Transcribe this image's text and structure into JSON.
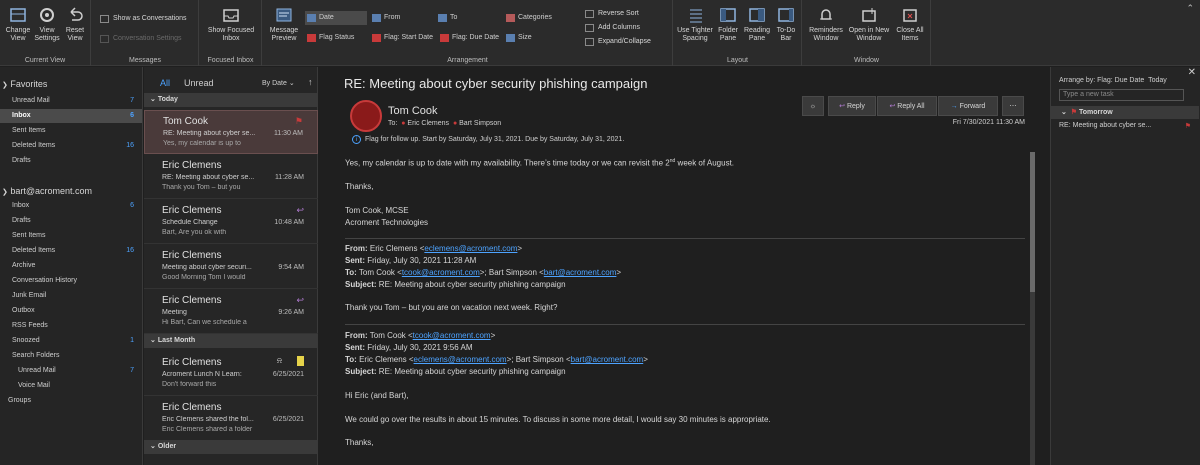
{
  "ribbon": {
    "current_view": {
      "label": "Current View",
      "change_view": "Change View",
      "view_settings": "View Settings",
      "reset_view": "Reset View"
    },
    "messages": {
      "label": "Messages",
      "show_as_conversations": "Show as Conversations",
      "conversation_settings": "Conversation Settings"
    },
    "focused_inbox": {
      "label": "Focused Inbox",
      "show_focused_inbox": "Show Focused Inbox"
    },
    "arrangement": {
      "label": "Arrangement",
      "message_preview": "Message Preview",
      "date": "Date",
      "from": "From",
      "to": "To",
      "categories": "Categories",
      "flag_status": "Flag Status",
      "flag_start_date": "Flag: Start Date",
      "flag_due_date": "Flag: Due Date",
      "size": "Size",
      "reverse_sort": "Reverse Sort",
      "add_columns": "Add Columns",
      "expand_collapse": "Expand/Collapse"
    },
    "layout": {
      "label": "Layout",
      "use_tighter_spacing": "Use Tighter Spacing",
      "folder_pane": "Folder Pane",
      "reading_pane": "Reading Pane",
      "todo_bar": "To-Do Bar"
    },
    "window": {
      "label": "Window",
      "reminders_window": "Reminders Window",
      "open_new_window": "Open in New Window",
      "close_all_items": "Close All Items"
    }
  },
  "folders": {
    "favorites_header": "Favorites",
    "favorites": [
      {
        "label": "Unread Mail",
        "count": "7"
      },
      {
        "label": "Inbox",
        "count": "6"
      },
      {
        "label": "Sent Items",
        "count": ""
      },
      {
        "label": "Deleted Items",
        "count": "16"
      },
      {
        "label": "Drafts",
        "count": ""
      }
    ],
    "account_header": "bart@acroment.com",
    "account": [
      {
        "label": "Inbox",
        "count": "6"
      },
      {
        "label": "Drafts",
        "count": ""
      },
      {
        "label": "Sent Items",
        "count": ""
      },
      {
        "label": "Deleted Items",
        "count": "16"
      },
      {
        "label": "Archive",
        "count": ""
      },
      {
        "label": "Conversation History",
        "count": ""
      },
      {
        "label": "Junk Email",
        "count": ""
      },
      {
        "label": "Outbox",
        "count": ""
      },
      {
        "label": "RSS Feeds",
        "count": ""
      },
      {
        "label": "Snoozed",
        "count": "1"
      },
      {
        "label": "Search Folders",
        "count": ""
      },
      {
        "label": "Unread Mail",
        "count": "7"
      },
      {
        "label": "Voice Mail",
        "count": ""
      },
      {
        "label": "Groups",
        "count": ""
      }
    ]
  },
  "list": {
    "tab_all": "All",
    "tab_unread": "Unread",
    "sort_label": "By Date",
    "today": "Today",
    "last_month": "Last Month",
    "older": "Older",
    "messages": [
      {
        "from": "Tom Cook",
        "subject": "RE: Meeting about cyber se...",
        "preview": "Yes, my calendar is up to",
        "time": "11:30 AM"
      },
      {
        "from": "Eric Clemens",
        "subject": "RE: Meeting about cyber se...",
        "preview": "Thank you Tom – but you",
        "time": "11:28 AM"
      },
      {
        "from": "Eric Clemens",
        "subject": "Schedule Change",
        "preview": "Bart,  Are you ok with",
        "time": "10:48 AM"
      },
      {
        "from": "Eric Clemens",
        "subject": "Meeting about cyber securi...",
        "preview": "Good Morning Tom  I would",
        "time": "9:54 AM"
      },
      {
        "from": "Eric Clemens",
        "subject": "Meeting",
        "preview": "Hi Bart,  Can we schedule a",
        "time": "9:26 AM"
      },
      {
        "from": "Eric Clemens",
        "subject": "Acroment Lunch N Learn:",
        "preview": "Don't forward this",
        "time": "6/25/2021"
      },
      {
        "from": "Eric Clemens",
        "subject": "Eric Clemens shared the fol...",
        "preview": "Eric Clemens shared a folder",
        "time": "6/25/2021"
      }
    ]
  },
  "reading": {
    "title": "RE: Meeting about cyber security phishing campaign",
    "sender": "Tom Cook",
    "to_label": "To:",
    "to1": "Eric Clemens",
    "to2": "Bart Simpson",
    "flag_line": "Flag for follow up.  Start by Saturday, July 31, 2021.  Due by Saturday, July 31, 2021.",
    "date": "Fri 7/30/2021 11:30 AM",
    "reply": "Reply",
    "reply_all": "Reply All",
    "forward": "Forward",
    "body1": "Yes, my calendar is up to date with my availability. There’s time today or we can revisit the 2",
    "body1_sup": "nd",
    "body1_end": " week of August.",
    "thanks": "Thanks,",
    "sig1": "Tom Cook, MCSE",
    "sig2": "Acroment Technologies",
    "from_label": "From:",
    "sent_label": "Sent:",
    "to_hdr": "To:",
    "subject_label": "Subject:",
    "q1_from": "Eric Clemens <",
    "q1_from_email": "eclemens@acroment.com",
    "q1_sent": "Friday, July 30, 2021 11:28 AM",
    "q1_to": "Tom Cook <",
    "q1_to_email1": "tcook@acroment.com",
    "q1_to_mid": ">; Bart Simpson <",
    "q1_to_email2": "bart@acroment.com",
    "q1_subject": "RE: Meeting about cyber security phishing campaign",
    "q1_body": "Thank you Tom – but you are on vacation next week. Right?",
    "q2_from": "Tom Cook <",
    "q2_from_email": "tcook@acroment.com",
    "q2_sent": "Friday, July 30, 2021 9:56 AM",
    "q2_to": "Eric Clemens <",
    "q2_to_email1": "eclemens@acroment.com",
    "q2_to_mid": ">; Bart Simpson <",
    "q2_to_email2": "bart@acroment.com",
    "q2_subject": "RE: Meeting about cyber security phishing campaign",
    "q2_greeting": "Hi Eric (and Bart),",
    "q2_body": "We could go over the results in about 15 minutes. To discuss in some more detail, I would say 30 minutes is appropriate.",
    "q2_thanks": "Thanks,"
  },
  "todo": {
    "arrange": "Arrange by: Flag: Due Date",
    "today": "Today",
    "new_task": "Type a new task",
    "tomorrow": "Tomorrow",
    "task1": "RE: Meeting about cyber se..."
  }
}
